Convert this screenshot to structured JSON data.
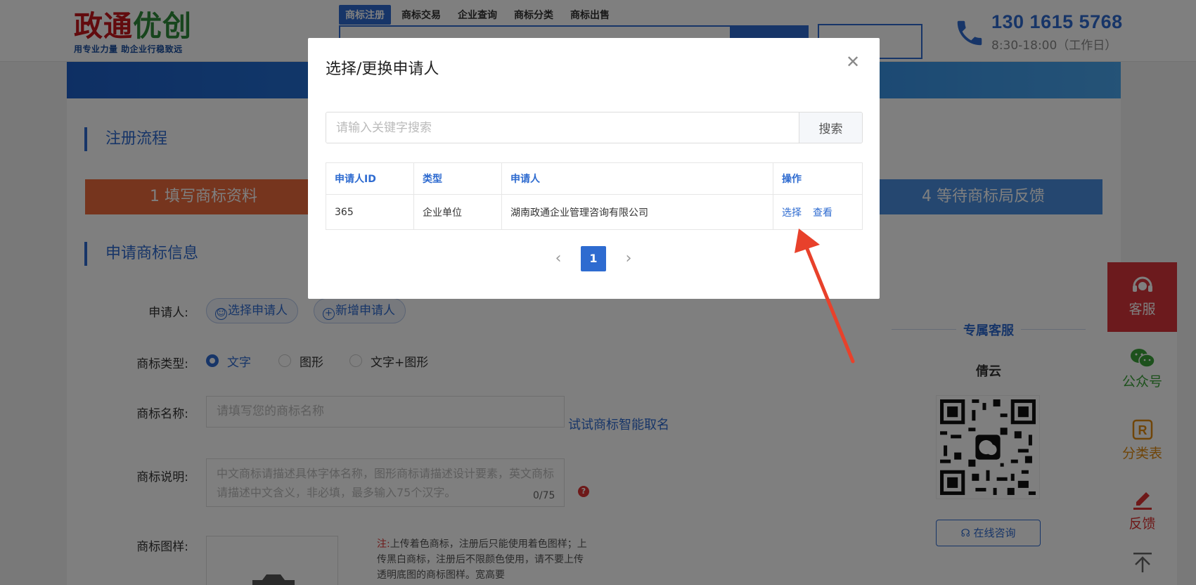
{
  "header": {
    "logo_main_red": "政通",
    "logo_main_green": "优创",
    "logo_sub": "用专业力量 助企业行稳致远",
    "nav": [
      "商标注册",
      "商标交易",
      "企业查询",
      "商标分类",
      "商标出售"
    ],
    "phone": "130 1615 5768",
    "hours": "8:30-18:00（工作日）"
  },
  "page": {
    "section_flow": "注册流程",
    "step1": "1 填写商标资料",
    "step4": "4 等待商标局反馈",
    "section_info": "申请商标信息",
    "applicant_label": "申请人:",
    "select_applicant": "选择申请人",
    "add_applicant": "新增申请人",
    "type_label": "商标类型:",
    "type_options": [
      "文字",
      "图形",
      "文字+图形"
    ],
    "name_label": "商标名称:",
    "name_placeholder": "请填写您的商标名称",
    "ai_naming_link": "试试商标智能取名",
    "desc_label": "商标说明:",
    "desc_placeholder": "中文商标请描述具体字体名称，图形商标请描述设计要素，英文商标请描述中文含义，非必填，最多输入75个汉字。",
    "desc_counter": "0/75",
    "image_label": "商标图样:",
    "note_prefix": "注:",
    "note_text": "上传着色商标，注册后只能使用着色图样；上传黑白商标，注册后不限颜色使用，请不要上传透明底图的商标图样。宽高要"
  },
  "service": {
    "title": "专属客服",
    "name": "倩云",
    "consult": "在线咨询"
  },
  "sidebar": {
    "kefu": "客服",
    "gzh": "公众号",
    "fenlei": "分类表",
    "fankui": "反馈"
  },
  "modal": {
    "title": "选择/更换申请人",
    "search_placeholder": "请输入关键字搜索",
    "search_button": "搜索",
    "columns": [
      "申请人ID",
      "类型",
      "申请人",
      "操作"
    ],
    "rows": [
      {
        "id": "365",
        "type": "企业单位",
        "name": "湖南政通企业管理咨询有限公司",
        "op_select": "选择",
        "op_view": "查看"
      }
    ],
    "current_page": "1"
  },
  "colors": {
    "primary": "#2e6bd0",
    "step1": "#ec6a3d",
    "step4": "#4a8fe0",
    "kefu_red": "#d9353a",
    "arrow": "#e8412b"
  }
}
